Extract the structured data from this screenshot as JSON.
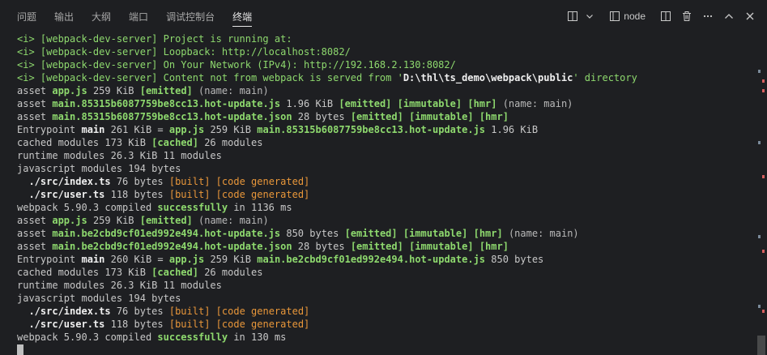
{
  "tabs": [
    {
      "label": "问题",
      "active": false
    },
    {
      "label": "输出",
      "active": false
    },
    {
      "label": "大纲",
      "active": false
    },
    {
      "label": "端口",
      "active": false
    },
    {
      "label": "调试控制台",
      "active": false
    },
    {
      "label": "终端",
      "active": true
    }
  ],
  "toolbar": {
    "profile_label": "node",
    "icons": [
      "terminal-layout-icon",
      "chevron-down-icon",
      "terminal-icon",
      "split-icon",
      "trash-icon",
      "more-icon",
      "chevron-up-icon",
      "close-icon"
    ]
  },
  "colors": {
    "green": "#8ed96e",
    "orange": "#e9973a",
    "text": "#c8c8c8",
    "background": "#1e1f22"
  },
  "terminal": {
    "lines": [
      [
        [
          "g",
          "<i> [webpack-dev-server] Project is running at:"
        ]
      ],
      [
        [
          "g",
          "<i> [webpack-dev-server] Loopback: http://localhost:8082/"
        ]
      ],
      [
        [
          "g",
          "<i> [webpack-dev-server] On Your Network (IPv4): http://192.168.2.130:8082/"
        ]
      ],
      [
        [
          "g",
          "<i> [webpack-dev-server] Content not from webpack is served from '"
        ],
        [
          "w",
          "D:\\thl\\ts_demo\\webpack\\public"
        ],
        [
          "g",
          "' directory"
        ]
      ],
      [
        [
          "t",
          "asset "
        ],
        [
          "gb",
          "app.js"
        ],
        [
          "t",
          " 259 KiB "
        ],
        [
          "gb",
          "[emitted]"
        ],
        [
          "p",
          " (name: main)"
        ]
      ],
      [
        [
          "t",
          "asset "
        ],
        [
          "gb",
          "main.85315b6087759be8cc13.hot-update.js"
        ],
        [
          "t",
          " 1.96 KiB "
        ],
        [
          "gb",
          "[emitted]"
        ],
        [
          "t",
          " "
        ],
        [
          "gb",
          "[immutable]"
        ],
        [
          "t",
          " "
        ],
        [
          "gb",
          "[hmr]"
        ],
        [
          "p",
          " (name: main)"
        ]
      ],
      [
        [
          "t",
          "asset "
        ],
        [
          "gb",
          "main.85315b6087759be8cc13.hot-update.json"
        ],
        [
          "t",
          " 28 bytes "
        ],
        [
          "gb",
          "[emitted]"
        ],
        [
          "t",
          " "
        ],
        [
          "gb",
          "[immutable]"
        ],
        [
          "t",
          " "
        ],
        [
          "gb",
          "[hmr]"
        ]
      ],
      [
        [
          "t",
          "Entrypoint "
        ],
        [
          "w",
          "main"
        ],
        [
          "t",
          " 261 KiB = "
        ],
        [
          "gb",
          "app.js"
        ],
        [
          "t",
          " 259 KiB "
        ],
        [
          "gb",
          "main.85315b6087759be8cc13.hot-update.js"
        ],
        [
          "t",
          " 1.96 KiB"
        ]
      ],
      [
        [
          "t",
          "cached modules 173 KiB "
        ],
        [
          "gb",
          "[cached]"
        ],
        [
          "t",
          " 26 modules"
        ]
      ],
      [
        [
          "t",
          "runtime modules 26.3 KiB 11 modules"
        ]
      ],
      [
        [
          "t",
          "javascript modules 194 bytes"
        ]
      ],
      [
        [
          "t",
          "  "
        ],
        [
          "w",
          "./src/index.ts"
        ],
        [
          "t",
          " 76 bytes "
        ],
        [
          "o",
          "[built]"
        ],
        [
          "t",
          " "
        ],
        [
          "o",
          "[code generated]"
        ]
      ],
      [
        [
          "t",
          "  "
        ],
        [
          "w",
          "./src/user.ts"
        ],
        [
          "t",
          " 118 bytes "
        ],
        [
          "o",
          "[built]"
        ],
        [
          "t",
          " "
        ],
        [
          "o",
          "[code generated]"
        ]
      ],
      [
        [
          "t",
          "webpack 5.90.3 compiled "
        ],
        [
          "gb",
          "successfully"
        ],
        [
          "t",
          " in 1136 ms"
        ]
      ],
      [
        [
          "t",
          "asset "
        ],
        [
          "gb",
          "app.js"
        ],
        [
          "t",
          " 259 KiB "
        ],
        [
          "gb",
          "[emitted]"
        ],
        [
          "p",
          " (name: main)"
        ]
      ],
      [
        [
          "t",
          "asset "
        ],
        [
          "gb",
          "main.be2cbd9cf01ed992e494.hot-update.js"
        ],
        [
          "t",
          " 850 bytes "
        ],
        [
          "gb",
          "[emitted]"
        ],
        [
          "t",
          " "
        ],
        [
          "gb",
          "[immutable]"
        ],
        [
          "t",
          " "
        ],
        [
          "gb",
          "[hmr]"
        ],
        [
          "p",
          " (name: main)"
        ]
      ],
      [
        [
          "t",
          "asset "
        ],
        [
          "gb",
          "main.be2cbd9cf01ed992e494.hot-update.json"
        ],
        [
          "t",
          " 28 bytes "
        ],
        [
          "gb",
          "[emitted]"
        ],
        [
          "t",
          " "
        ],
        [
          "gb",
          "[immutable]"
        ],
        [
          "t",
          " "
        ],
        [
          "gb",
          "[hmr]"
        ]
      ],
      [
        [
          "t",
          "Entrypoint "
        ],
        [
          "w",
          "main"
        ],
        [
          "t",
          " 260 KiB = "
        ],
        [
          "gb",
          "app.js"
        ],
        [
          "t",
          " 259 KiB "
        ],
        [
          "gb",
          "main.be2cbd9cf01ed992e494.hot-update.js"
        ],
        [
          "t",
          " 850 bytes"
        ]
      ],
      [
        [
          "t",
          "cached modules 173 KiB "
        ],
        [
          "gb",
          "[cached]"
        ],
        [
          "t",
          " 26 modules"
        ]
      ],
      [
        [
          "t",
          "runtime modules 26.3 KiB 11 modules"
        ]
      ],
      [
        [
          "t",
          "javascript modules 194 bytes"
        ]
      ],
      [
        [
          "t",
          "  "
        ],
        [
          "w",
          "./src/index.ts"
        ],
        [
          "t",
          " 76 bytes "
        ],
        [
          "o",
          "[built]"
        ],
        [
          "t",
          " "
        ],
        [
          "o",
          "[code generated]"
        ]
      ],
      [
        [
          "t",
          "  "
        ],
        [
          "w",
          "./src/user.ts"
        ],
        [
          "t",
          " 118 bytes "
        ],
        [
          "o",
          "[built]"
        ],
        [
          "t",
          " "
        ],
        [
          "o",
          "[code generated]"
        ]
      ],
      [
        [
          "t",
          "webpack 5.90.3 compiled "
        ],
        [
          "gb",
          "successfully"
        ],
        [
          "t",
          " in 130 ms"
        ]
      ]
    ]
  }
}
